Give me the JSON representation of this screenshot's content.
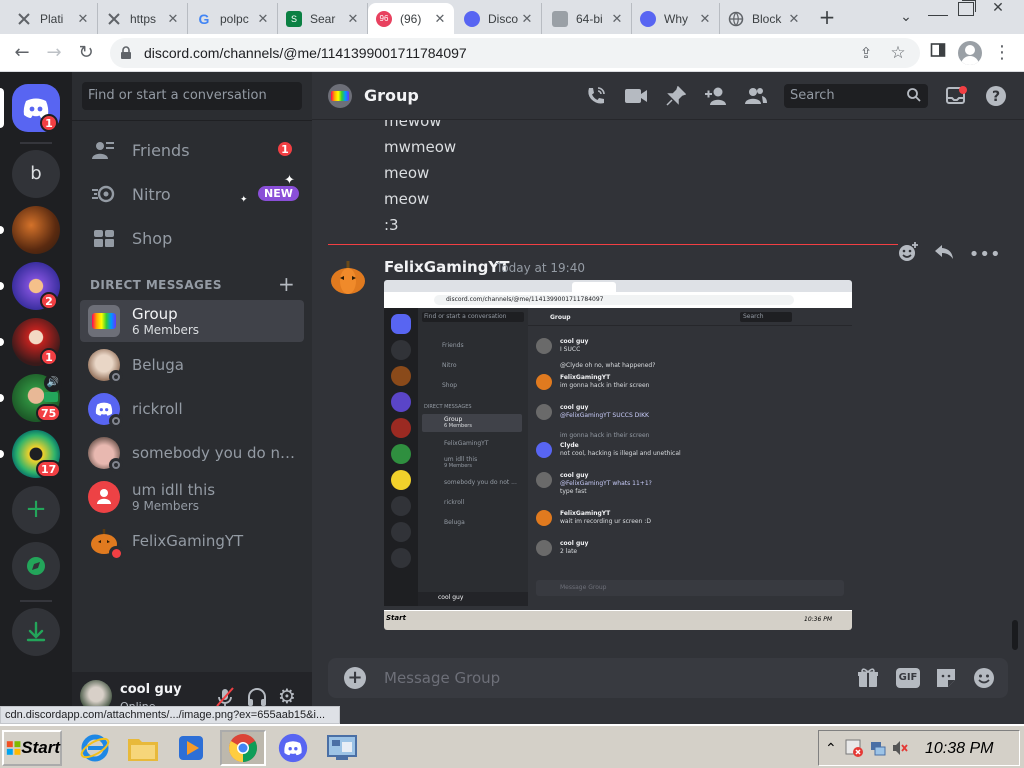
{
  "browser": {
    "tabs": [
      {
        "label": "Plati",
        "color": "#5f6368"
      },
      {
        "label": "https",
        "color": "#5f6368"
      },
      {
        "label": "polpc",
        "color": "#4285f4"
      },
      {
        "label": "Sear",
        "color": "#0b8043"
      },
      {
        "label": "(96)",
        "color": "#5865f2",
        "badge": "96"
      },
      {
        "label": "Disco",
        "color": "#5865f2"
      },
      {
        "label": "64-bi",
        "color": "#5f6368"
      },
      {
        "label": "Why",
        "color": "#5865f2"
      },
      {
        "label": "Block",
        "color": "#5f6368"
      }
    ],
    "url": "discord.com/channels/@me/1141399001711784097",
    "status_url": "cdn.discordapp.com/attachments/.../image.png?ex=655aab15&i..."
  },
  "servers": [
    {
      "name": "home",
      "badge": "1"
    },
    {
      "name": "b",
      "label": "b"
    },
    {
      "name": "server-2",
      "badge": ""
    },
    {
      "name": "server-3",
      "badge": "2"
    },
    {
      "name": "server-4",
      "badge": "1"
    },
    {
      "name": "server-5",
      "badge": "75"
    },
    {
      "name": "server-6",
      "badge": "17"
    }
  ],
  "sidebar": {
    "search_placeholder": "Find or start a conversation",
    "friends": "Friends",
    "friends_badge": "1",
    "nitro": "Nitro",
    "nitro_badge": "NEW",
    "shop": "Shop",
    "dm_header": "DIRECT MESSAGES",
    "dms": [
      {
        "name": "Group",
        "sub": "6 Members",
        "color": "#d6a3d6"
      },
      {
        "name": "Beluga",
        "sub": "",
        "color": "#c8a38a"
      },
      {
        "name": "rickroll",
        "sub": "",
        "color": "#5865f2"
      },
      {
        "name": "somebody you do not ...",
        "sub": "",
        "color": "#b8938a"
      },
      {
        "name": "um idll this",
        "sub": "9 Members",
        "color": "#ed4245"
      },
      {
        "name": "FelixGamingYT",
        "sub": "",
        "color": "#e07a1f"
      }
    ]
  },
  "user": {
    "name": "cool guy",
    "status": "Online"
  },
  "chat": {
    "channel": "Group",
    "search": "Search",
    "lines": [
      "mewow",
      "mwmeow",
      "meow",
      "meow",
      ":3"
    ],
    "author": "FelixGamingYT",
    "timestamp": "Today at 19:40",
    "composer_placeholder": "Message Group",
    "gif": "GIF"
  },
  "embed": {
    "url": "discord.com/channels/@me/1141399001711784097",
    "search_placeholder": "Find or start a conversation",
    "friends": "Friends",
    "nitro": "Nitro",
    "shop": "Shop",
    "dm_header": "DIRECT MESSAGES",
    "dms": [
      "Group",
      "FelixGamingYT",
      "um idll this",
      "somebody you do not ...",
      "rickroll",
      "Beluga"
    ],
    "group_members": "6 Members",
    "um_members": "9 Members",
    "channel": "Group",
    "search": "Search",
    "messages": [
      {
        "author": "cool guy",
        "time": "Today at 19:37",
        "text": "I SUCC"
      },
      {
        "author": "",
        "time": "",
        "text": "@Clyde oh no, what happened?"
      },
      {
        "author": "FelixGamingYT",
        "time": "Today at 19:37",
        "text": "im gonna hack in their screen"
      },
      {
        "author": "cool guy",
        "time": "Today at 19:37",
        "text": "@FelixGamingYT SUCCS DIKK"
      },
      {
        "author": "",
        "time": "",
        "text": "im gonna hack in their screen"
      },
      {
        "author": "Clyde",
        "time": "Today at 19:37",
        "text": "not cool, hacking is illegal and unethical"
      },
      {
        "author": "cool guy",
        "time": "Today at 19:38",
        "text": "@FelixGamingYT whats 11+1?"
      },
      {
        "author": "",
        "time": "",
        "text": "type fast"
      },
      {
        "author": "FelixGamingYT",
        "time": "Today at 19:38",
        "text": "wait im recording ur screen :D"
      },
      {
        "author": "cool guy",
        "time": "Today at 19:39",
        "text": "2 late"
      }
    ],
    "composer": "Message Group",
    "user": "cool guy",
    "clock": "10:36 PM",
    "start": "Start"
  },
  "taskbar": {
    "start": "Start",
    "clock": "10:38 PM"
  }
}
